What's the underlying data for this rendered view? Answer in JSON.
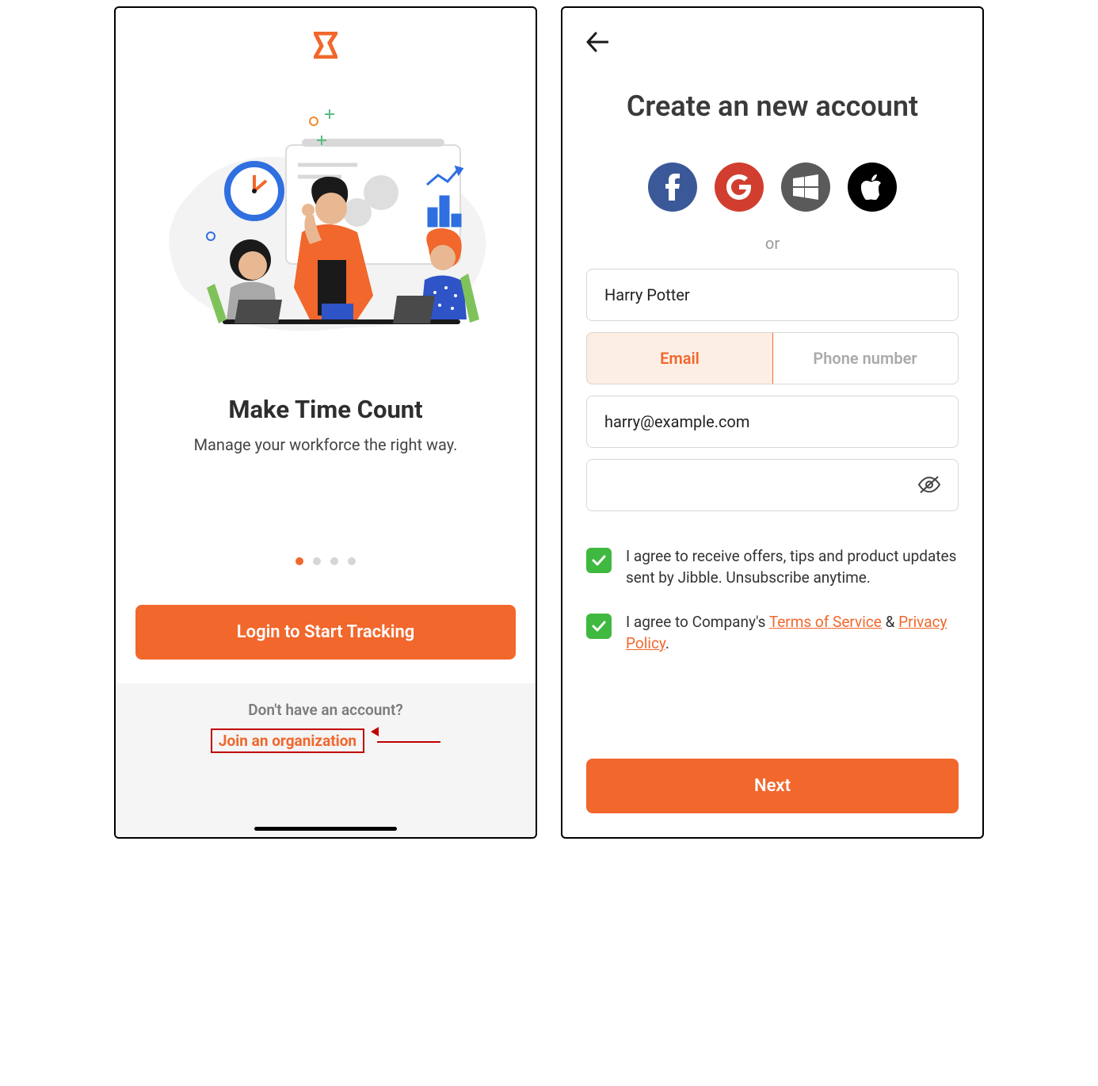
{
  "left": {
    "hero_title": "Make Time Count",
    "hero_subtitle": "Manage your workforce the right way.",
    "login_button": "Login to Start Tracking",
    "no_account": "Don't have an account?",
    "join_org": "Join an organization",
    "dot_count": 4,
    "active_dot": 0
  },
  "right": {
    "title": "Create an new account",
    "or_label": "or",
    "name_value": "Harry Potter",
    "tab_email": "Email",
    "tab_phone": "Phone number",
    "email_value": "harry@example.com",
    "password_value": "",
    "check1": "I agree to receive offers, tips and product updates sent by Jibble. Unsubscribe anytime.",
    "check2_prefix": "I agree to Company's ",
    "check2_tos": "Terms of Service",
    "check2_amp": " & ",
    "check2_pp": "Privacy Policy",
    "check2_suffix": ".",
    "next_button": "Next"
  },
  "colors": {
    "accent": "#f1672c",
    "green": "#3fb93f"
  }
}
